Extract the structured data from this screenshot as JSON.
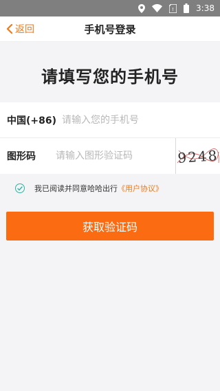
{
  "statusbar": {
    "time": "3:38",
    "icons": [
      "location-icon",
      "wifi-icon",
      "sim-icon",
      "battery-icon"
    ]
  },
  "header": {
    "back_label": "返回",
    "title": "手机号登录"
  },
  "headline": "请填写您的手机号",
  "phone": {
    "label": "中国(+86)",
    "placeholder": "请输入您的手机号",
    "value": ""
  },
  "captcha": {
    "label": "图形码",
    "placeholder": "请输入图形验证码",
    "value": "",
    "image_text": "9248"
  },
  "agreement": {
    "text": "我已阅读并同意哈哈出行",
    "link": "《用户协议》",
    "checked": true
  },
  "submit_label": "获取验证码",
  "colors": {
    "accent": "#fa6b12",
    "link": "#f07a1a",
    "check": "#2bb3a0"
  }
}
